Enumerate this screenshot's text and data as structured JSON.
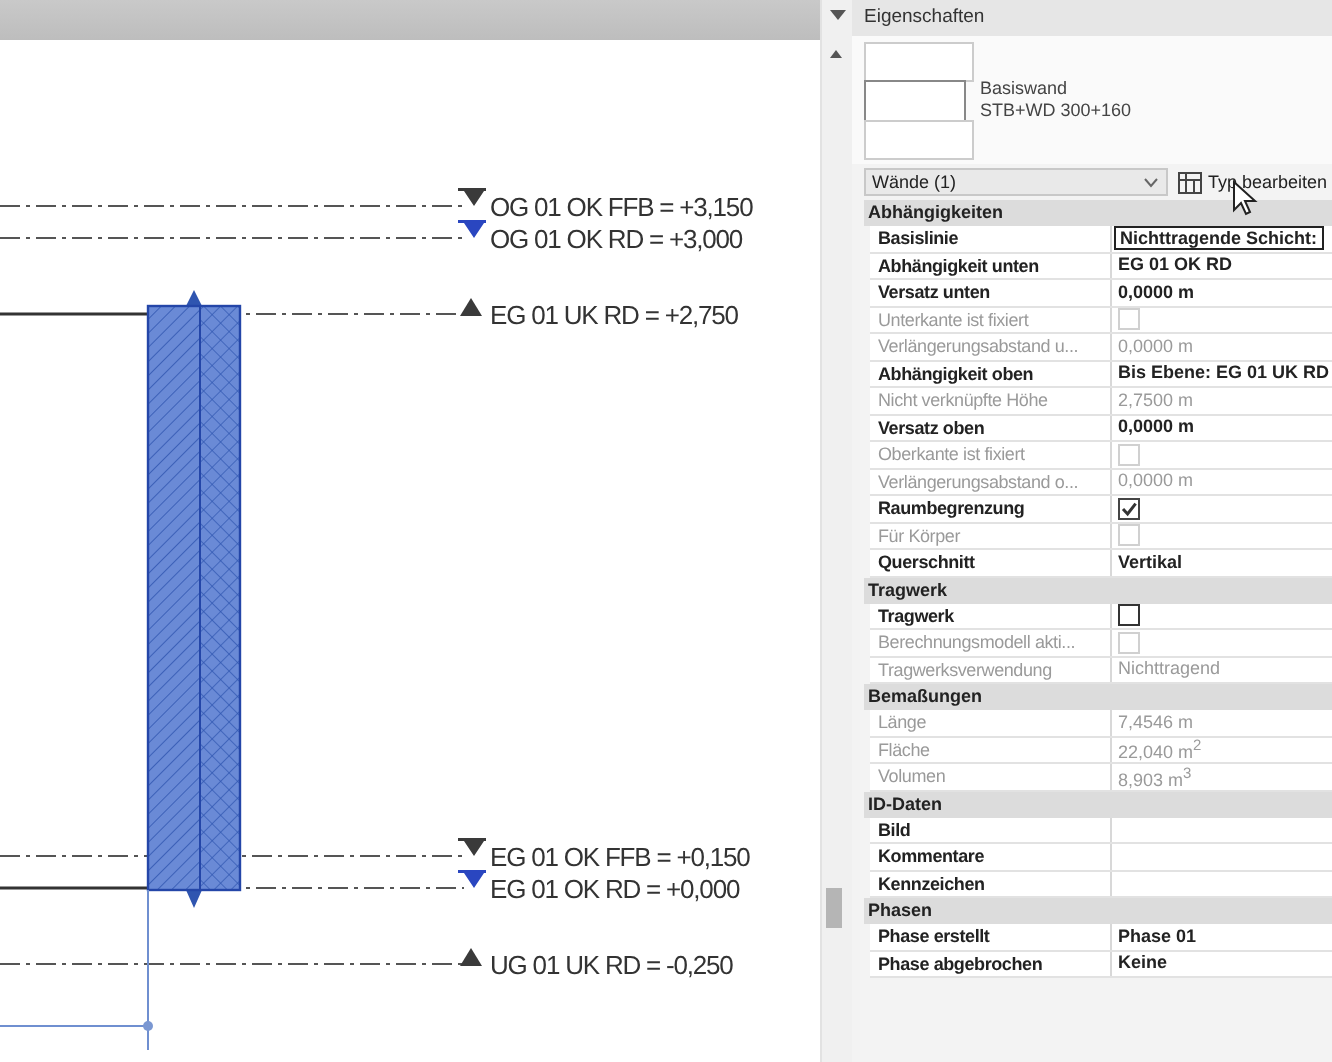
{
  "canvas": {
    "levels": [
      {
        "label": "OG 01 OK FFB = +3,150",
        "kind": "down",
        "color": "#3a3a3a"
      },
      {
        "label": "OG 01 OK RD = +3,000",
        "kind": "down",
        "color": "#2a46c0"
      },
      {
        "label": "EG 01 UK RD = +2,750",
        "kind": "up",
        "color": "#3a3a3a"
      },
      {
        "label": "EG 01 OK FFB = +0,150",
        "kind": "down",
        "color": "#3a3a3a"
      },
      {
        "label": "EG 01 OK RD = +0,000",
        "kind": "down",
        "color": "#2a46c0"
      },
      {
        "label": "UG 01 UK RD = -0,250",
        "kind": "up",
        "color": "#3a3a3a"
      }
    ]
  },
  "properties": {
    "title": "Eigenschaften",
    "type_name": "Basiswand",
    "type_detail": "STB+WD 300+160",
    "selector": "Wände (1)",
    "edit_type_button": "Typ bearbeiten",
    "sections": [
      {
        "title": "Abhängigkeiten",
        "rows": [
          {
            "label": "Basislinie",
            "kind": "field",
            "value": "Nichttragende Schicht:",
            "disabled": false
          },
          {
            "label": "Abhängigkeit unten",
            "kind": "text",
            "value": "EG 01 OK RD",
            "disabled": false
          },
          {
            "label": "Versatz unten",
            "kind": "text",
            "value": "0,0000 m",
            "disabled": false
          },
          {
            "label": "Unterkante ist fixiert",
            "kind": "checkbox",
            "checked": false,
            "disabled": true
          },
          {
            "label": "Verlängerungsabstand u...",
            "kind": "text",
            "value": "0,0000 m",
            "disabled": true
          },
          {
            "label": "Abhängigkeit oben",
            "kind": "text",
            "value": "Bis Ebene: EG 01 UK RD",
            "disabled": false
          },
          {
            "label": "Nicht verknüpfte Höhe",
            "kind": "text",
            "value": "2,7500 m",
            "disabled": true
          },
          {
            "label": "Versatz oben",
            "kind": "text",
            "value": "0,0000 m",
            "disabled": false
          },
          {
            "label": "Oberkante ist fixiert",
            "kind": "checkbox",
            "checked": false,
            "disabled": true
          },
          {
            "label": "Verlängerungsabstand o...",
            "kind": "text",
            "value": "0,0000 m",
            "disabled": true
          },
          {
            "label": "Raumbegrenzung",
            "kind": "checkbox",
            "checked": true,
            "disabled": false
          },
          {
            "label": "Für Körper",
            "kind": "checkbox",
            "checked": false,
            "disabled": true
          },
          {
            "label": "Querschnitt",
            "kind": "text",
            "value": "Vertikal",
            "disabled": false
          }
        ]
      },
      {
        "title": "Tragwerk",
        "rows": [
          {
            "label": "Tragwerk",
            "kind": "checkbox",
            "checked": false,
            "disabled": false
          },
          {
            "label": "Berechnungsmodell akti...",
            "kind": "checkbox",
            "checked": false,
            "disabled": true
          },
          {
            "label": "Tragwerksverwendung",
            "kind": "text",
            "value": "Nichttragend",
            "disabled": true
          }
        ]
      },
      {
        "title": "Bemaßungen",
        "rows": [
          {
            "label": "Länge",
            "kind": "text",
            "value": "7,4546 m",
            "disabled": true
          },
          {
            "label": "Fläche",
            "kind": "text",
            "value": "22,040 m$^{2}$",
            "disabled": true
          },
          {
            "label": "Volumen",
            "kind": "text",
            "value": "8,903 m$^{3}$",
            "disabled": true
          }
        ]
      },
      {
        "title": "ID-Daten",
        "rows": [
          {
            "label": "Bild",
            "kind": "text",
            "disabled": false
          },
          {
            "label": "Kommentare",
            "kind": "text",
            "disabled": false
          },
          {
            "label": "Kennzeichen",
            "kind": "text",
            "disabled": false
          }
        ]
      },
      {
        "title": "Phasen",
        "rows": [
          {
            "label": "Phase erstellt",
            "kind": "text",
            "value": "Phase 01",
            "disabled": false
          },
          {
            "label": "Phase abgebrochen",
            "kind": "text",
            "value": "Keine",
            "disabled": false
          }
        ]
      }
    ]
  }
}
